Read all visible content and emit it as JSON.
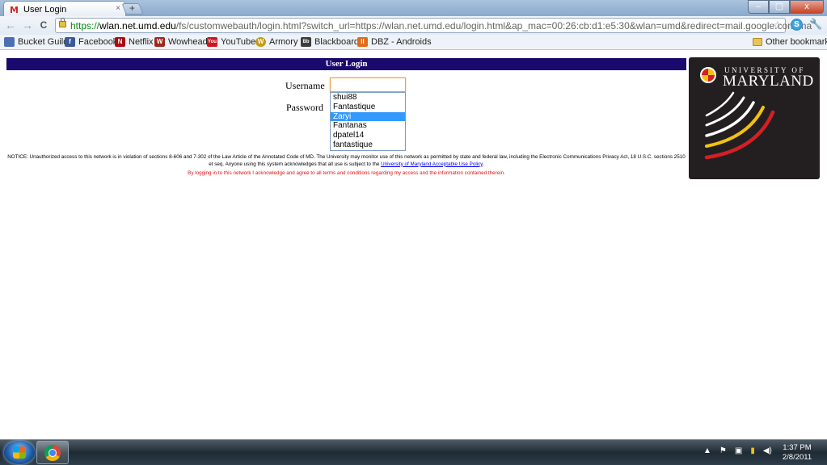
{
  "browser": {
    "tab_title": "User Login",
    "tab_favicon": "M",
    "tab_close": "×",
    "new_tab": "+",
    "window_buttons": {
      "minimize": "–",
      "maximize": "▢",
      "close": "x"
    },
    "nav": {
      "back": "←",
      "forward": "→",
      "reload": "C"
    },
    "url": {
      "scheme": "https://",
      "host": "wlan.net.umd.edu",
      "path": "/fs/customwebauth/login.html?switch_url=https://wlan.net.umd.edu/login.html&ap_mac=00:26:cb:d1:e5:30&wlan=umd&redirect=mail.google.com/ma"
    },
    "star": "☆",
    "extension_icon_letter": "S",
    "wrench": "🔧"
  },
  "bookmarks": {
    "items": [
      {
        "label": "Bucket Guild",
        "icon": "group-icon",
        "color": "#4a6fb5",
        "glyph": "👥"
      },
      {
        "label": "Facebook",
        "icon": "facebook-icon",
        "color": "#3b5998",
        "glyph": "f"
      },
      {
        "label": "Netflix",
        "icon": "netflix-icon",
        "color": "#b20710",
        "glyph": "N"
      },
      {
        "label": "Wowhead",
        "icon": "wowhead-icon",
        "color": "#a0281e",
        "glyph": "W"
      },
      {
        "label": "YouTube",
        "icon": "youtube-icon",
        "color": "#cc181e",
        "glyph": "You"
      },
      {
        "label": "Armory",
        "icon": "armory-icon",
        "color": "#c59a15",
        "glyph": "W"
      },
      {
        "label": "Blackboard",
        "icon": "blackboard-icon",
        "color": "#3d3d3d",
        "glyph": "Bb"
      },
      {
        "label": "DBZ - Androids",
        "icon": "dbz-icon",
        "color": "#e06b1a",
        "glyph": "II"
      }
    ],
    "other": "Other bookmarks"
  },
  "page": {
    "header": "User Login",
    "username_label": "Username",
    "password_label": "Password",
    "autocomplete": [
      "shui88",
      "Fantastique",
      "Zaryi",
      "Fantanas",
      "dpatel14",
      "fantastique"
    ],
    "autocomplete_selected": "Zaryi",
    "notice_text": "NOTICE: Unauthorized access to this network is in violation of sections 8-606 and 7-302 of the Law Article of the Annotated Code of MD. The University may monitor use of this network as permitted by state and federal law, including the Electronic Communications Privacy Act, 18 U.S.C. sections 2510 et seq. Anyone using this system acknowledges that all use is subject to the ",
    "notice_link": "University of Maryland Acceptable Use Policy",
    "notice_end": ".",
    "notice_red": "By logging in to this network I acknowledge and agree to all terms and conditions regarding my access and the information contained therein.",
    "logo_university_of": "UNIVERSITY OF",
    "logo_maryland": "MARYLAND",
    "colors": {
      "header_bar": "#1a0a6e",
      "red_notice": "#e01010",
      "logo_red": "#d31f26",
      "logo_gold": "#f4c20d"
    }
  },
  "taskbar": {
    "tray_icons": [
      "show-hidden-icon",
      "flag-icon",
      "network-icon",
      "signal-icon",
      "volume-icon"
    ],
    "tray_glyphs": [
      "▲",
      "⚑",
      "▣",
      "▮",
      "◀)"
    ],
    "time": "1:37 PM",
    "date": "2/8/2011"
  }
}
